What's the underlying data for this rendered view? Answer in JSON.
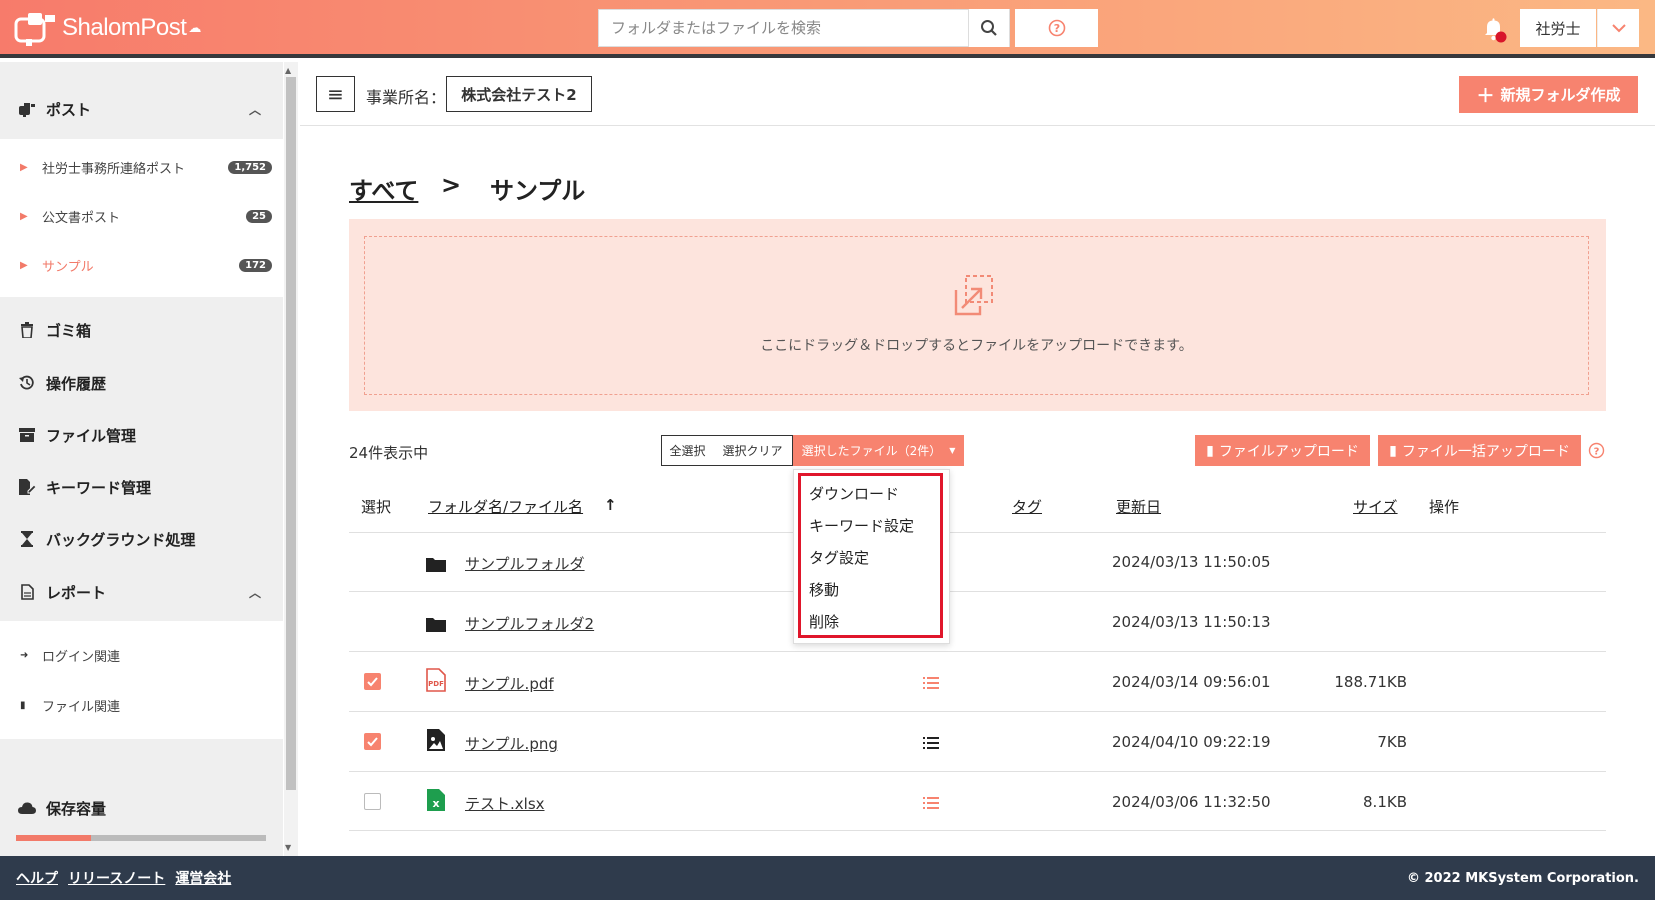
{
  "header": {
    "logo_text": "ShalomPost",
    "search_placeholder": "フォルダまたはファイルを検索",
    "user_label": "社労士"
  },
  "sidebar": {
    "post_group": "ポスト",
    "post_items": [
      {
        "label": "社労士事務所連絡ポスト",
        "badge": "1,752"
      },
      {
        "label": "公文書ポスト",
        "badge": "25"
      },
      {
        "label": "サンプル",
        "badge": "172"
      }
    ],
    "trash": "ゴミ箱",
    "history": "操作履歴",
    "file_manage": "ファイル管理",
    "keyword_manage": "キーワード管理",
    "background": "バックグラウンド処理",
    "report_group": "レポート",
    "report_items": [
      "ログイン関連",
      "ファイル関連"
    ],
    "storage": "保存容量",
    "storage_used_fraction": 0.3
  },
  "toolbar": {
    "office_label": "事業所名：",
    "office_name": "株式会社テスト2",
    "new_folder": "新規フォルダ作成"
  },
  "breadcrumb": {
    "all": "すべて",
    "sep": ">",
    "current": "サンプル"
  },
  "dropzone": {
    "text": "ここにドラッグ＆ドロップするとファイルをアップロードできます。"
  },
  "list": {
    "count": "24件表示中",
    "select_all": "全選択",
    "clear": "選択クリア",
    "selected_files": "選択したファイル（2件）",
    "upload": "ファイルアップロード",
    "bulk_upload": "ファイル一括アップロード"
  },
  "table": {
    "headers": {
      "select": "選択",
      "name": "フォルダ名/ファイル名",
      "tag": "タグ",
      "updated": "更新日",
      "size": "サイズ",
      "ops": "操作"
    },
    "rows": [
      {
        "name": "サンプルフォルダ",
        "type": "folder-icon",
        "date": "2024/03/13 11:50:05",
        "size": "",
        "checked": false
      },
      {
        "name": "サンプルフォルダ2",
        "type": "folder-icon",
        "date": "2024/03/13 11:50:13",
        "size": "",
        "checked": false
      },
      {
        "name": "サンプル.pdf",
        "type": "pdf-icon",
        "date": "2024/03/14 09:56:01",
        "size": "188.71KB",
        "checked": true
      },
      {
        "name": "サンプル.png",
        "type": "image-icon",
        "date": "2024/04/10 09:22:19",
        "size": "7KB",
        "checked": true
      },
      {
        "name": "テスト.xlsx",
        "type": "excel-icon",
        "date": "2024/03/06 11:32:50",
        "size": "8.1KB",
        "checked": false
      }
    ]
  },
  "dropdown": {
    "items": [
      "ダウンロード",
      "キーワード設定",
      "タグ設定",
      "移動",
      "削除"
    ]
  },
  "footer": {
    "help": "ヘルプ",
    "release": "リリースノート",
    "company": "運営会社",
    "copyright": "© 2022 MKSystem Corporation."
  },
  "colors": {
    "accent": "#f7836f",
    "highlight": "#e0162b",
    "footer": "#2f3b4c"
  }
}
